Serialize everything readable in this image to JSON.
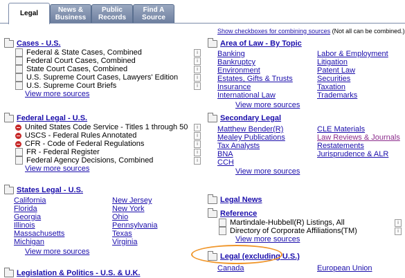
{
  "tabs": [
    {
      "label": "Legal",
      "active": true
    },
    {
      "label": "News & Business",
      "active": false
    },
    {
      "label": "Public Records",
      "active": false
    },
    {
      "label": "Find A Source",
      "active": false
    }
  ],
  "notice": {
    "link": "Show checkboxes for combining sources",
    "suffix": " (Not all can be combined.)"
  },
  "left": {
    "cases": {
      "title": "Cases - U.S.",
      "items": [
        "Federal & State Cases, Combined",
        "Federal Court Cases, Combined",
        "State Court Cases, Combined",
        "U.S. Supreme Court Cases, Lawyers' Edition",
        "U.S. Supreme Court Briefs"
      ],
      "more": "View more sources"
    },
    "federal": {
      "title": "Federal Legal - U.S.",
      "items": [
        "United States Code Service - Titles 1 through 50",
        "USCS - Federal Rules Annotated",
        "CFR - Code of Federal Regulations",
        "FR - Federal Register",
        "Federal Agency Decisions, Combined"
      ],
      "more": "View more sources"
    },
    "states": {
      "title": "States Legal - U.S.",
      "col1": [
        "California",
        "Florida",
        "Georgia",
        "Illinois",
        "Massachusetts",
        "Michigan"
      ],
      "col2": [
        "New Jersey",
        "New York",
        "Ohio",
        "Pennsylvania",
        "Texas",
        "Virginia"
      ],
      "more": "View more sources"
    },
    "legislation": {
      "title": "Legislation & Politics - U.S. & U.K."
    }
  },
  "right": {
    "area": {
      "title": "Area of Law - By Topic",
      "col1": [
        "Banking",
        "Bankruptcy",
        "Environment",
        "Estates, Gifts & Trusts",
        "Insurance",
        "International Law"
      ],
      "col2": [
        "Labor & Employment",
        "Litigation",
        "Patent Law",
        "Securities",
        "Taxation",
        "Trademarks"
      ],
      "more": "View more sources"
    },
    "secondary": {
      "title": "Secondary Legal",
      "col1": [
        "Matthew Bender(R)",
        "Mealey Publications",
        "Tax Analysts",
        "BNA",
        "CCH"
      ],
      "col2": [
        "CLE Materials",
        "Law Reviews & Journals",
        "Restatements",
        "Jurisprudence & ALR"
      ],
      "more": "View more sources"
    },
    "news": {
      "title": "Legal News"
    },
    "reference": {
      "title": "Reference",
      "items": [
        "Martindale-Hubbell(R) Listings, All",
        "Directory of Corporate Affiliations(TM)"
      ],
      "more": "View more sources"
    },
    "nonus": {
      "title": "Legal (excluding U.S.)",
      "col1": [
        "Canada"
      ],
      "col2": [
        "European Union"
      ]
    }
  },
  "info_glyph": "i",
  "highlight_color": "#f0962a"
}
